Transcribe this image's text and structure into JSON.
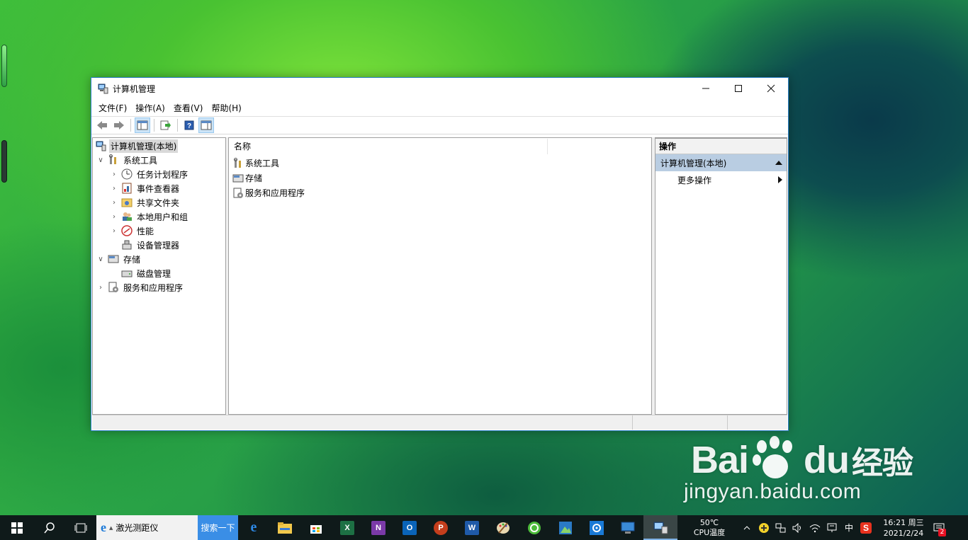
{
  "window": {
    "title": "计算机管理",
    "menu": [
      "文件(F)",
      "操作(A)",
      "查看(V)",
      "帮助(H)"
    ]
  },
  "tree": {
    "root": "计算机管理(本地)",
    "system_tools": "系统工具",
    "task_scheduler": "任务计划程序",
    "event_viewer": "事件查看器",
    "shared_folders": "共享文件夹",
    "local_users": "本地用户和组",
    "performance": "性能",
    "device_manager": "设备管理器",
    "storage": "存储",
    "disk_management": "磁盘管理",
    "services_apps": "服务和应用程序"
  },
  "list": {
    "column_name": "名称",
    "items": [
      "系统工具",
      "存储",
      "服务和应用程序"
    ]
  },
  "actions": {
    "header": "操作",
    "section": "计算机管理(本地)",
    "more": "更多操作"
  },
  "taskbar": {
    "search_text": "激光测距仪",
    "search_button": "搜索一下",
    "cpu_temp": "50℃",
    "cpu_label": "CPU温度",
    "ime": "中",
    "time": "16:21 周三",
    "date": "2021/2/24",
    "notification_count": "2"
  },
  "watermark": {
    "logo_left": "Bai",
    "logo_right": "du",
    "logo_cn": "经验",
    "url": "jingyan.baidu.com"
  }
}
